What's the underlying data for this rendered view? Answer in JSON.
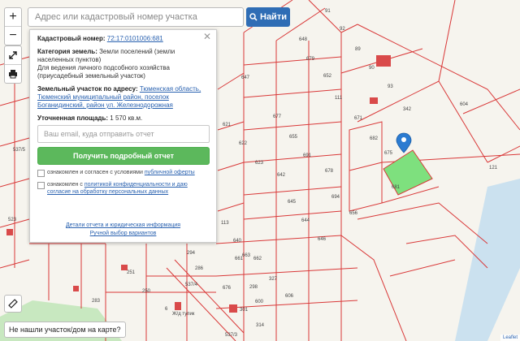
{
  "search": {
    "placeholder": "Адрес или кадастровый номер участка",
    "button_label": "Найти"
  },
  "zoom": {
    "in_label": "+",
    "out_label": "−"
  },
  "panel": {
    "cad_label": "Кадастровый номер:",
    "cad_value": "72:17:0101006:681",
    "category_label": "Категория земель:",
    "category_value": "Земли поселений (земли населенных пунктов)",
    "usage_text": "Для ведения личного подсобного хозяйства (приусадебный земельный участок)",
    "address_label": "Земельный участок по адресу:",
    "address_value": "Тюменская область, Тюменский муниципальный район, поселок Боганидинский, район ул. Железнодорожная",
    "area_label": "Уточненная площадь:",
    "area_value": "1 570 кв.м.",
    "email_placeholder": "Ваш email, куда отправить отчет",
    "get_report_label": "Получить подробный отчет",
    "agree_offer_prefix": "ознакомлен и согласен с условиями",
    "agree_offer_link": "публичной оферты",
    "agree_privacy_prefix": "ознакомлен с",
    "agree_privacy_link": "политикой конфиденциальности и даю согласие на обработку персональных данных",
    "report_details_link": "Детали отчета и юридическая информация",
    "manual_select_link": "Ручной выбор вариантов"
  },
  "not_found_label": "Не нашли участок/дом на карте?",
  "attribution": "Leaflet",
  "map_labels": [
    "648",
    "679",
    "652",
    "647",
    "621",
    "622",
    "623",
    "677",
    "655",
    "691",
    "642",
    "645",
    "644",
    "646",
    "678",
    "694",
    "656",
    "682",
    "675",
    "681",
    "121",
    "604",
    "342",
    "93",
    "90",
    "111",
    "671",
    "89",
    "92",
    "91",
    "113",
    "640",
    "661",
    "663",
    "662",
    "327",
    "676",
    "298",
    "600",
    "301",
    "314",
    "606",
    "250",
    "251",
    "294",
    "286",
    "283",
    "6",
    "523",
    "537/5",
    "537/3",
    "537/4",
    "Ж/д тупик"
  ],
  "colors": {
    "parcel_line": "#d93838",
    "selected_fill": "#7ee07e",
    "marker": "#2b7bd1",
    "building": "#d94a4a"
  }
}
